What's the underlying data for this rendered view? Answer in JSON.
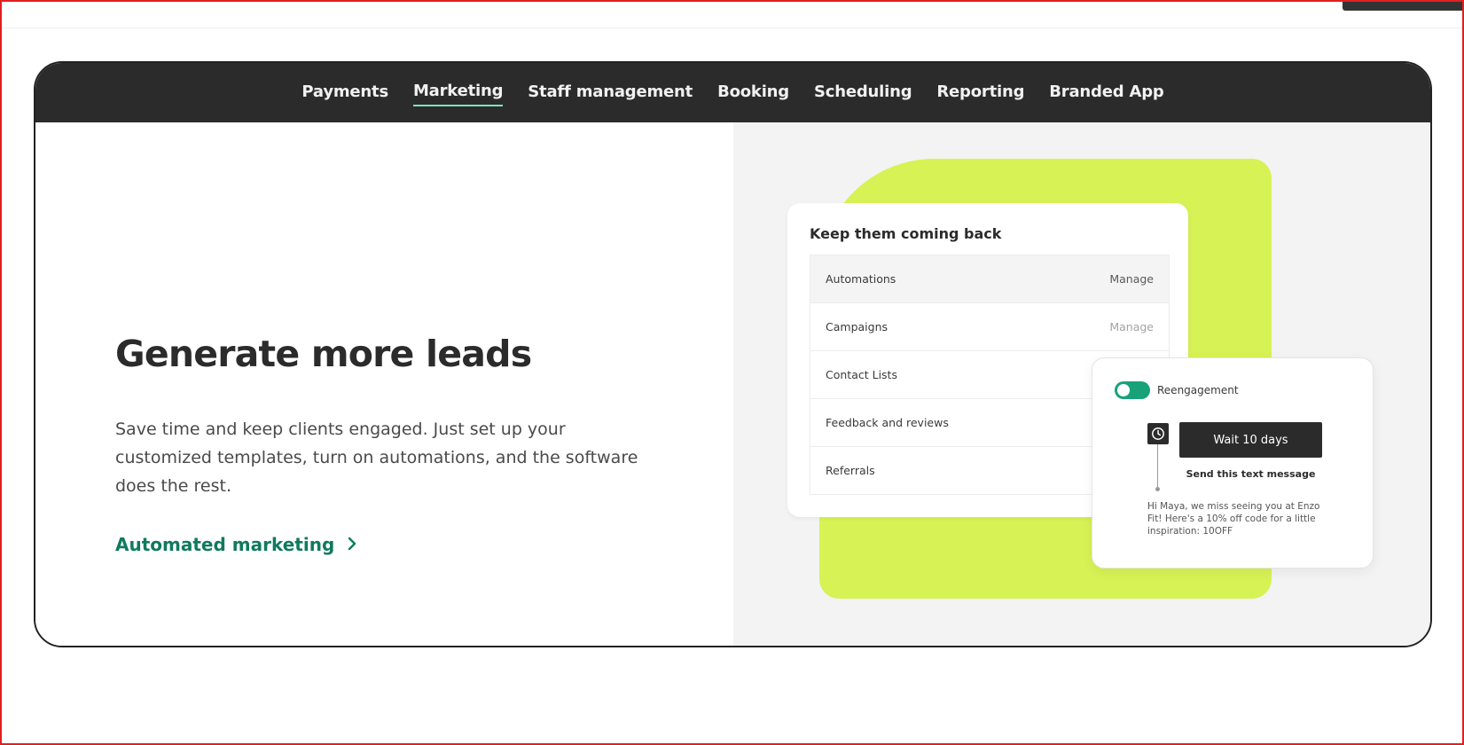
{
  "nav": {
    "items": [
      {
        "label": "Payments"
      },
      {
        "label": "Marketing",
        "active": true
      },
      {
        "label": "Staff management"
      },
      {
        "label": "Booking"
      },
      {
        "label": "Scheduling"
      },
      {
        "label": "Reporting"
      },
      {
        "label": "Branded App"
      }
    ]
  },
  "hero": {
    "headline": "Generate more leads",
    "body": "Save time and keep clients engaged. Just set up your customized templates, turn on automations, and the software does the rest.",
    "cta_label": "Automated marketing",
    "cta_icon": "chevron-right-icon"
  },
  "panel": {
    "title": "Keep them coming back",
    "rows": [
      {
        "label": "Automations",
        "action": "Manage"
      },
      {
        "label": "Campaigns",
        "action": "Manage"
      },
      {
        "label": "Contact Lists"
      },
      {
        "label": "Feedback and reviews"
      },
      {
        "label": "Referrals"
      }
    ]
  },
  "popup": {
    "toggle_label": "Reengagement",
    "toggle_on": true,
    "wait_button": "Wait 10 days",
    "send_label": "Send this text message",
    "message": "Hi Maya, we miss seeing you at Enzo Fit! Here's a 10% off code for a little inspiration: 10OFF",
    "clock_icon": "clock-icon"
  },
  "colors": {
    "nav_bg": "#2b2b2b",
    "accent_green": "#0f7a5f",
    "toggle_green": "#19a27a",
    "lime": "#d7f255",
    "active_underline": "#7fe0c4"
  }
}
